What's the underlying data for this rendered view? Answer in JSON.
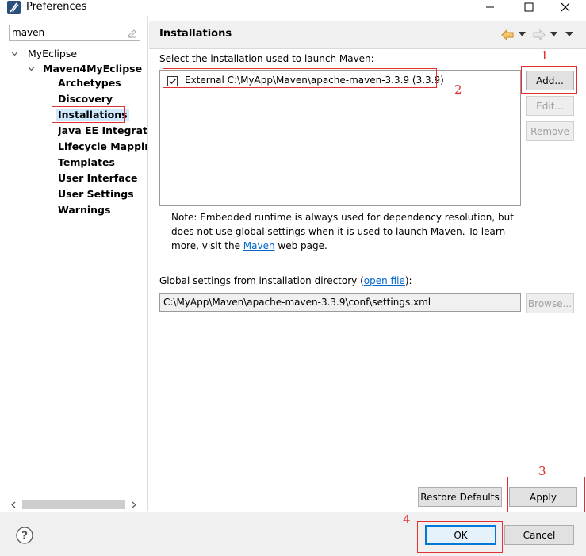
{
  "window": {
    "title": "Preferences"
  },
  "filter": {
    "value": "maven"
  },
  "tree": {
    "root": "MyEclipse",
    "group": "Maven4MyEclipse",
    "items": [
      "Archetypes",
      "Discovery",
      "Installations",
      "Java EE Integratio",
      "Lifecycle Mappin",
      "Templates",
      "User Interface",
      "User Settings",
      "Warnings"
    ],
    "selected_index": 2
  },
  "page": {
    "title": "Installations",
    "select_label": "Select the installation used to launch Maven:",
    "installation_row": "External C:\\MyApp\\Maven\\apache-maven-3.3.9 (3.3.9)",
    "installation_checked": true,
    "note_line1": "Note: Embedded runtime is always used for dependency resolution, but",
    "note_line2": "does not use global settings when it is used to launch Maven. To learn",
    "note_line3_pre": "more, visit the ",
    "note_link": "Maven",
    "note_line3_post": " web page.",
    "global_label_pre": "Global settings from installation directory (",
    "global_link": "open file",
    "global_label_post": "):",
    "global_path": "C:\\MyApp\\Maven\\apache-maven-3.3.9\\conf\\settings.xml"
  },
  "buttons": {
    "add": "Add...",
    "edit": "Edit...",
    "remove": "Remove",
    "browse": "Browse...",
    "restore": "Restore Defaults",
    "apply": "Apply",
    "ok": "OK",
    "cancel": "Cancel"
  },
  "annotations": {
    "n1": "1",
    "n2": "2",
    "n3": "3",
    "n4": "4"
  },
  "colors": {
    "annotation": "#e03030",
    "selection": "#cde8ff",
    "link": "#0066cc",
    "back_arrow": "#e8a23a"
  }
}
